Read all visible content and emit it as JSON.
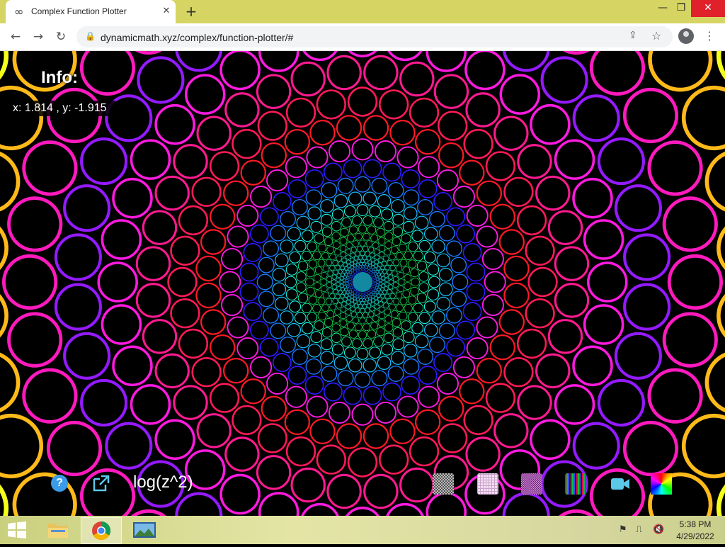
{
  "browser": {
    "tab_title": "Complex Function Plotter",
    "tab_icon": "infinity-icon",
    "url": "dynamicmath.xyz/complex/function-plotter/#"
  },
  "page": {
    "info_title": "Info:",
    "coords": "x: 1.814 , y: -1.915",
    "function": "log(z^2)",
    "help_symbol": "?"
  },
  "taskbar": {
    "time": "5:38 PM",
    "date": "4/29/2022"
  },
  "colors": {
    "titlebar": "#d6d564",
    "close_button": "#e0202a",
    "help_button": "#3a9be8",
    "video_button": "#5bc8e8"
  }
}
